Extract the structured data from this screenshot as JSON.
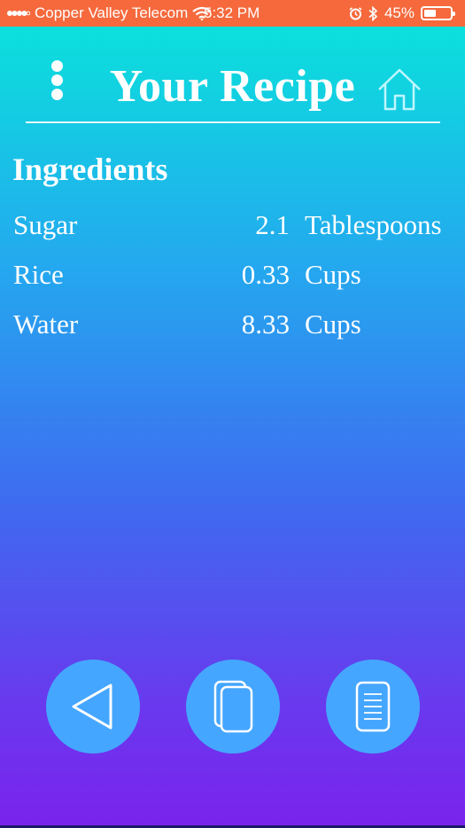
{
  "status_bar": {
    "carrier": "Copper Valley Telecom",
    "time": "5:32 PM",
    "battery": "45%",
    "battery_level": 0.45,
    "icons": [
      "signal-icon",
      "wifi-icon",
      "alarm-icon",
      "bluetooth-icon",
      "battery-icon"
    ],
    "background": "#f5693c"
  },
  "header": {
    "title": "Your Recipe",
    "icons": [
      "menu-dots-icon",
      "home-icon"
    ]
  },
  "ingredients": {
    "title": "Ingredients",
    "items": [
      {
        "name": "Sugar",
        "quantity": "2.1",
        "unit": "Tablespoons"
      },
      {
        "name": "Rice",
        "quantity": "0.33",
        "unit": "Cups"
      },
      {
        "name": "Water",
        "quantity": "8.33",
        "unit": "Cups"
      }
    ]
  },
  "bottom_nav": {
    "buttons": [
      {
        "icon": "back-triangle-icon"
      },
      {
        "icon": "copy-pages-icon"
      },
      {
        "icon": "document-list-icon"
      }
    ],
    "button_color": "#45a6ff"
  },
  "colors": {
    "gradient_top": "#0be0dc",
    "gradient_bottom": "#7a23ec",
    "text": "#ffffff"
  }
}
